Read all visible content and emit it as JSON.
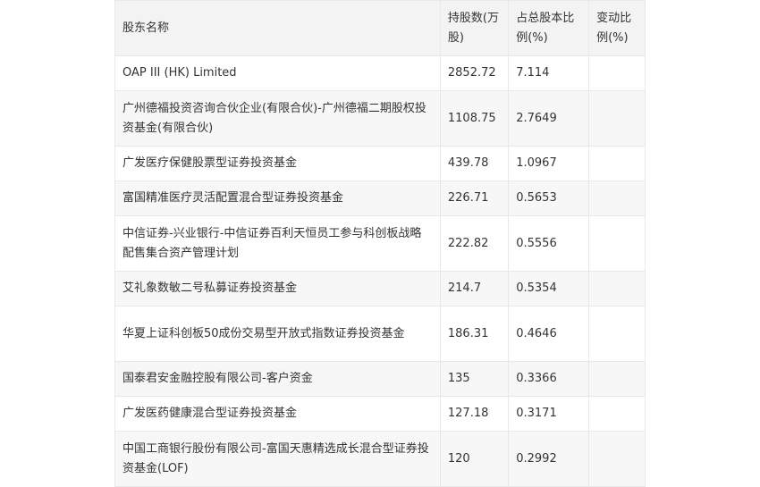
{
  "table": {
    "headers": {
      "name": "股东名称",
      "shares": "持股数(万股)",
      "ratio": "占总股本比例(%)",
      "change": "变动比例(%)"
    },
    "rows": [
      {
        "name": "OAP III (HK) Limited",
        "shares": "2852.72",
        "ratio": "7.114",
        "change": ""
      },
      {
        "name": "广州德福投资咨询合伙企业(有限合伙)-广州德福二期股权投资基金(有限合伙)",
        "shares": "1108.75",
        "ratio": "2.7649",
        "change": ""
      },
      {
        "name": "广发医疗保健股票型证券投资基金",
        "shares": "439.78",
        "ratio": "1.0967",
        "change": ""
      },
      {
        "name": "富国精准医疗灵活配置混合型证券投资基金",
        "shares": "226.71",
        "ratio": "0.5653",
        "change": ""
      },
      {
        "name": "中信证券-兴业银行-中信证券百利天恒员工参与科创板战略配售集合资产管理计划",
        "shares": "222.82",
        "ratio": "0.5556",
        "change": ""
      },
      {
        "name": "艾礼象数敏二号私募证券投资基金",
        "shares": "214.7",
        "ratio": "0.5354",
        "change": ""
      },
      {
        "name": "华夏上证科创板50成份交易型开放式指数证券投资基金",
        "shares": "186.31",
        "ratio": "0.4646",
        "change": ""
      },
      {
        "name": "国泰君安金融控股有限公司-客户资金",
        "shares": "135",
        "ratio": "0.3366",
        "change": ""
      },
      {
        "name": "广发医药健康混合型证券投资基金",
        "shares": "127.18",
        "ratio": "0.3171",
        "change": ""
      },
      {
        "name": "中国工商银行股份有限公司-富国天惠精选成长混合型证券投资基金(LOF)",
        "shares": "120",
        "ratio": "0.2992",
        "change": ""
      }
    ]
  }
}
